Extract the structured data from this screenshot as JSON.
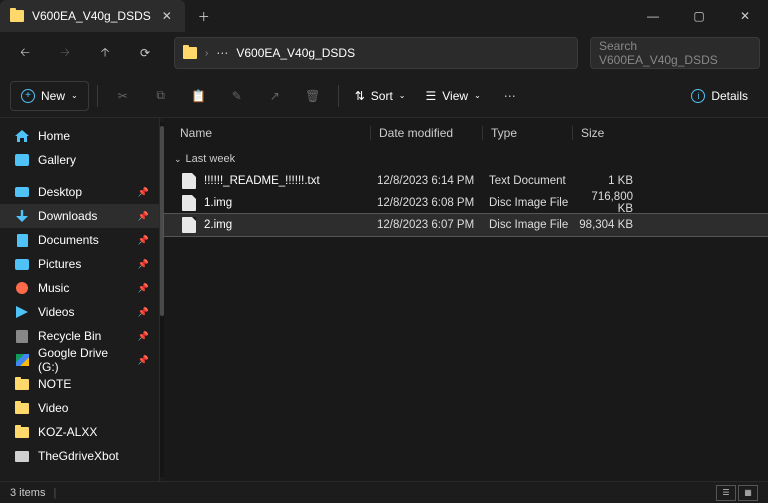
{
  "tab": {
    "title": "V600EA_V40g_DSDS"
  },
  "address": {
    "path": "V600EA_V40g_DSDS"
  },
  "search": {
    "placeholder": "Search V600EA_V40g_DSDS"
  },
  "toolbar": {
    "new_label": "New",
    "sort_label": "Sort",
    "view_label": "View",
    "details_label": "Details"
  },
  "sidebar": {
    "items": [
      {
        "label": "Home"
      },
      {
        "label": "Gallery"
      },
      {
        "label": "Desktop"
      },
      {
        "label": "Downloads"
      },
      {
        "label": "Documents"
      },
      {
        "label": "Pictures"
      },
      {
        "label": "Music"
      },
      {
        "label": "Videos"
      },
      {
        "label": "Recycle Bin"
      },
      {
        "label": "Google Drive (G:)"
      },
      {
        "label": "NOTE"
      },
      {
        "label": "Video"
      },
      {
        "label": "KOZ-ALXX"
      },
      {
        "label": "TheGdriveXbot"
      }
    ]
  },
  "columns": {
    "name": "Name",
    "date": "Date modified",
    "type": "Type",
    "size": "Size"
  },
  "group": {
    "label": "Last week"
  },
  "files": [
    {
      "name": "!!!!!!_README_!!!!!!.txt",
      "date": "12/8/2023 6:14 PM",
      "type": "Text Document",
      "size": "1 KB"
    },
    {
      "name": "1.img",
      "date": "12/8/2023 6:08 PM",
      "type": "Disc Image File",
      "size": "716,800 KB"
    },
    {
      "name": "2.img",
      "date": "12/8/2023 6:07 PM",
      "type": "Disc Image File",
      "size": "98,304 KB"
    }
  ],
  "status": {
    "count": "3 items"
  }
}
